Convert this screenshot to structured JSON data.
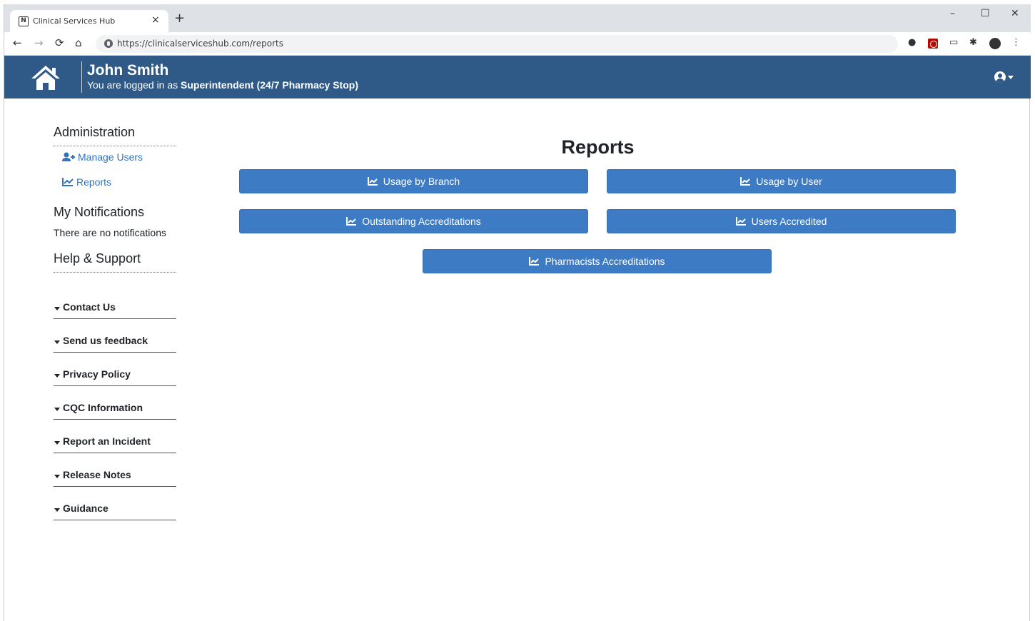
{
  "browser": {
    "tab_title": "Clinical Services Hub",
    "tab_close": "×",
    "new_tab": "+",
    "url": "https://clinicalserviceshub.com/reports",
    "window_controls": {
      "minimize": "–",
      "maximize": "☐",
      "close": "✕"
    },
    "nav": {
      "back": "←",
      "forward": "→",
      "reload": "⟳",
      "home": "⌂"
    },
    "extensions": {
      "ext1": "●",
      "cast": "▭",
      "puzzle": "✱",
      "menu": "⋮"
    }
  },
  "header": {
    "user_name": "John Smith",
    "logged_prefix": "You are logged in as ",
    "logged_role": "Superintendent (24/7 Pharmacy Stop)",
    "home_icon": "house-icon",
    "account_icon": "user-circle-icon",
    "brand_color": "#2f5987"
  },
  "sidebar": {
    "administration": {
      "heading": "Administration",
      "items": [
        {
          "label": "Manage Users",
          "icon": "user-plus-icon"
        },
        {
          "label": "Reports",
          "icon": "line-chart-icon"
        }
      ]
    },
    "notifications": {
      "heading": "My Notifications",
      "empty_text": "There are no notifications"
    },
    "help": {
      "heading": "Help & Support",
      "sections": [
        "Contact Us",
        "Send us feedback",
        "Privacy Policy",
        "CQC Information",
        "Report an Incident",
        "Release Notes",
        "Guidance"
      ]
    },
    "link_color": "#3073c0"
  },
  "main": {
    "title": "Reports",
    "buttons": [
      "Usage by Branch",
      "Usage by User",
      "Outstanding Accreditations",
      "Users Accredited",
      "Pharmacists Accreditations"
    ],
    "button_icon": "line-chart-icon",
    "button_color": "#3d7cc4"
  }
}
